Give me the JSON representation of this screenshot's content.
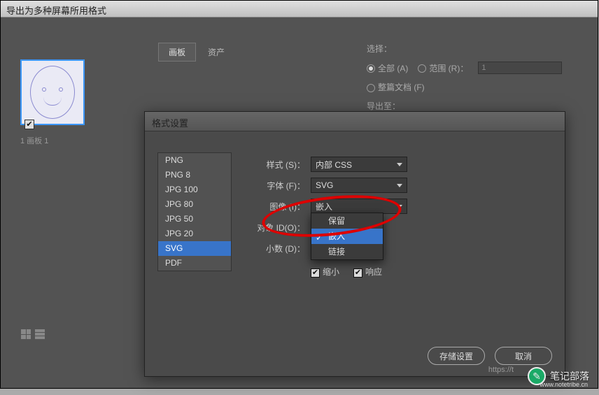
{
  "window": {
    "title": "导出为多种屏幕所用格式"
  },
  "tabs": {
    "items": [
      "画板",
      "资产"
    ],
    "active": 0
  },
  "artboard": {
    "label": "1  画板 1",
    "checked": true
  },
  "select_panel": {
    "label": "选择：",
    "options": {
      "all": "全部 (A)",
      "range": "范围 (R)：",
      "range_value": "1",
      "full_doc": "整篇文档 (F)"
    },
    "selected": "all",
    "export_label": "导出至："
  },
  "dialog": {
    "title": "格式设置",
    "format_list": [
      "PNG",
      "PNG 8",
      "JPG 100",
      "JPG 80",
      "JPG 50",
      "JPG 20",
      "SVG",
      "PDF"
    ],
    "format_selected": 6,
    "form": {
      "style": {
        "label": "样式 (S)：",
        "value": "内部 CSS"
      },
      "font": {
        "label": "字体 (F)：",
        "value": "SVG"
      },
      "image": {
        "label": "图像 (I)：",
        "value": "嵌入"
      },
      "object_id": {
        "label": "对象 ID(O)："
      },
      "decimal": {
        "label": "小数 (D)："
      }
    },
    "dropdown": {
      "items": [
        "保留",
        "嵌入",
        "链接"
      ],
      "highlighted": 1,
      "checked": 1
    },
    "checks": {
      "minify": "缩小",
      "responsive": "响应"
    },
    "buttons": {
      "save": "存储设置",
      "cancel": "取消"
    }
  },
  "watermark": {
    "text": "笔记部落",
    "url": "www.notetribe.cn",
    "https": "https://t"
  }
}
